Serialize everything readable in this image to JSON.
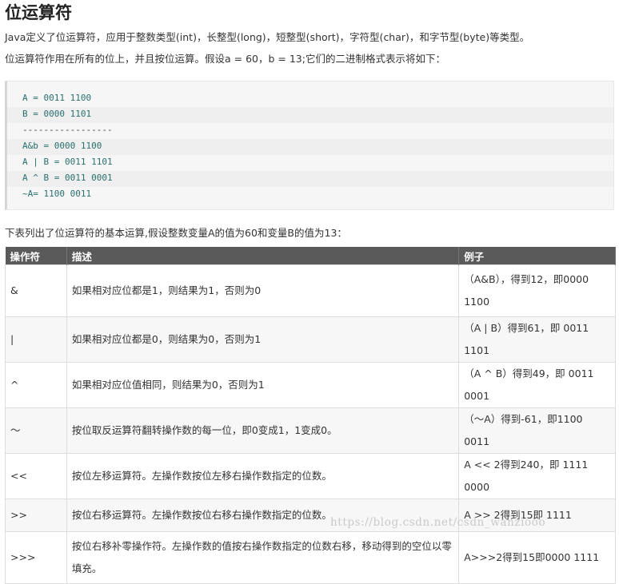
{
  "title": "位运算符",
  "intro": [
    "Java定义了位运算符，应用于整数类型(int)，长整型(long)，短整型(short)，字符型(char)，和字节型(byte)等类型。",
    "位运算符作用在所有的位上，并且按位运算。假设a = 60，b = 13;它们的二进制格式表示将如下："
  ],
  "code_lines": [
    "A = 0011 1100",
    "B = 0000 1101",
    "-----------------",
    "A&b = 0000 1100",
    "A | B = 0011 1101",
    "A ^ B = 0011 0001",
    "~A= 1100 0011"
  ],
  "table_intro": "下表列出了位运算符的基本运算,假设整数变量A的值为60和变量B的值为13：",
  "table": {
    "headers": [
      "操作符",
      "描述",
      "例子"
    ],
    "rows": [
      {
        "op": "&",
        "desc": "如果相对应位都是1，则结果为1，否则为0",
        "example": "（A&B），得到12，即0000 1100"
      },
      {
        "op": "|",
        "desc": "如果相对应位都是0，则结果为0，否则为1",
        "example": "（A | B）得到61，即 0011 1101"
      },
      {
        "op": "^",
        "desc": "如果相对应位值相同，则结果为0，否则为1",
        "example": "（A ^ B）得到49，即 0011 0001"
      },
      {
        "op": "〜",
        "desc": "按位取反运算符翻转操作数的每一位，即0变成1，1变成0。",
        "example": "（〜A）得到-61，即1100 0011"
      },
      {
        "op": "<<",
        "desc": "按位左移运算符。左操作数按位左移右操作数指定的位数。",
        "example": "A << 2得到240，即 1111 0000"
      },
      {
        "op": ">>",
        "desc": "按位右移运算符。左操作数按位右移右操作数指定的位数。",
        "example": "A >> 2得到15即 1111"
      },
      {
        "op": ">>>",
        "desc": "按位右移补零操作符。左操作数的值按右操作数指定的位数右移，移动得到的空位以零填充。",
        "example": "A>>>2得到15即0000 1111"
      }
    ]
  },
  "watermark": "https://blog.csdn.net/csdn_wanziooo"
}
